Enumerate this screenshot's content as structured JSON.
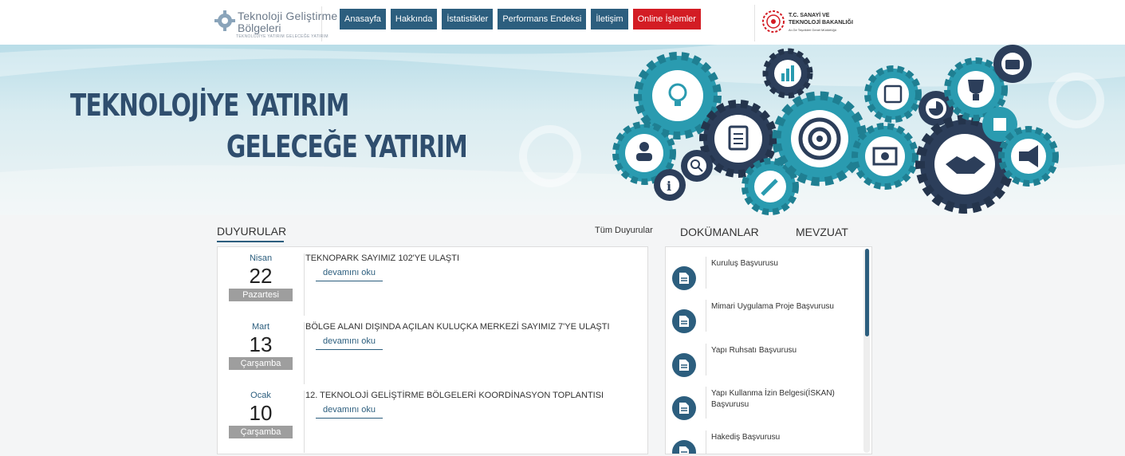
{
  "header": {
    "logo": {
      "line1": "Teknoloji Geliştirme",
      "line2": "Bölgeleri",
      "tagline": "TEKNOLOJİYE YATIRIM GELECEĞE YATIRIM"
    },
    "nav": [
      {
        "label": "Anasayfa"
      },
      {
        "label": "Hakkında"
      },
      {
        "label": "İstatistikler"
      },
      {
        "label": "Performans Endeksi"
      },
      {
        "label": "İletişim"
      },
      {
        "label": "Online İşlemler"
      }
    ],
    "ministry": {
      "line1": "T.C. SANAYİ VE",
      "line2": "TEKNOLOJİ BAKANLIĞI",
      "line3": "Ar-Ge Teşvikleri Genel Müdürlüğü"
    }
  },
  "banner": {
    "slogan_line1": "TEKNOLOJİYE YATIRIM",
    "slogan_line2": "GELECEĞE YATIRIM"
  },
  "announcements": {
    "title": "DUYURULAR",
    "all_link": "Tüm Duyurular",
    "read_more": "devamını oku",
    "items": [
      {
        "month": "Nisan",
        "day": "22",
        "weekday": "Pazartesi",
        "text": "TEKNOPARK SAYIMIZ 102'YE ULAŞTI"
      },
      {
        "month": "Mart",
        "day": "13",
        "weekday": "Çarşamba",
        "text": "BÖLGE ALANI DIŞINDA AÇILAN KULUÇKA MERKEZİ SAYIMIZ 7'YE ULAŞTI"
      },
      {
        "month": "Ocak",
        "day": "10",
        "weekday": "Çarşamba",
        "text": "12. TEKNOLOJİ GELİŞTİRME BÖLGELERİ KOORDİNASYON TOPLANTISI"
      }
    ]
  },
  "documents": {
    "tabs": [
      {
        "label": "DOKÜMANLAR"
      },
      {
        "label": "MEVZUAT"
      }
    ],
    "items": [
      {
        "label": "Kuruluş Başvurusu"
      },
      {
        "label": "Mimari Uygulama Proje Başvurusu"
      },
      {
        "label": "Yapı Ruhsatı Başvurusu"
      },
      {
        "label": "Yapı Kullanma İzin Belgesi(İSKAN) Başvurusu"
      },
      {
        "label": "Hakediş Başvurusu"
      }
    ]
  },
  "colors": {
    "primary": "#2c5e7e",
    "accent": "#d31c24",
    "slogan": "#2f4e6e",
    "gear_teal": "#2a9bb0",
    "gear_dark": "#2c3e5a"
  }
}
